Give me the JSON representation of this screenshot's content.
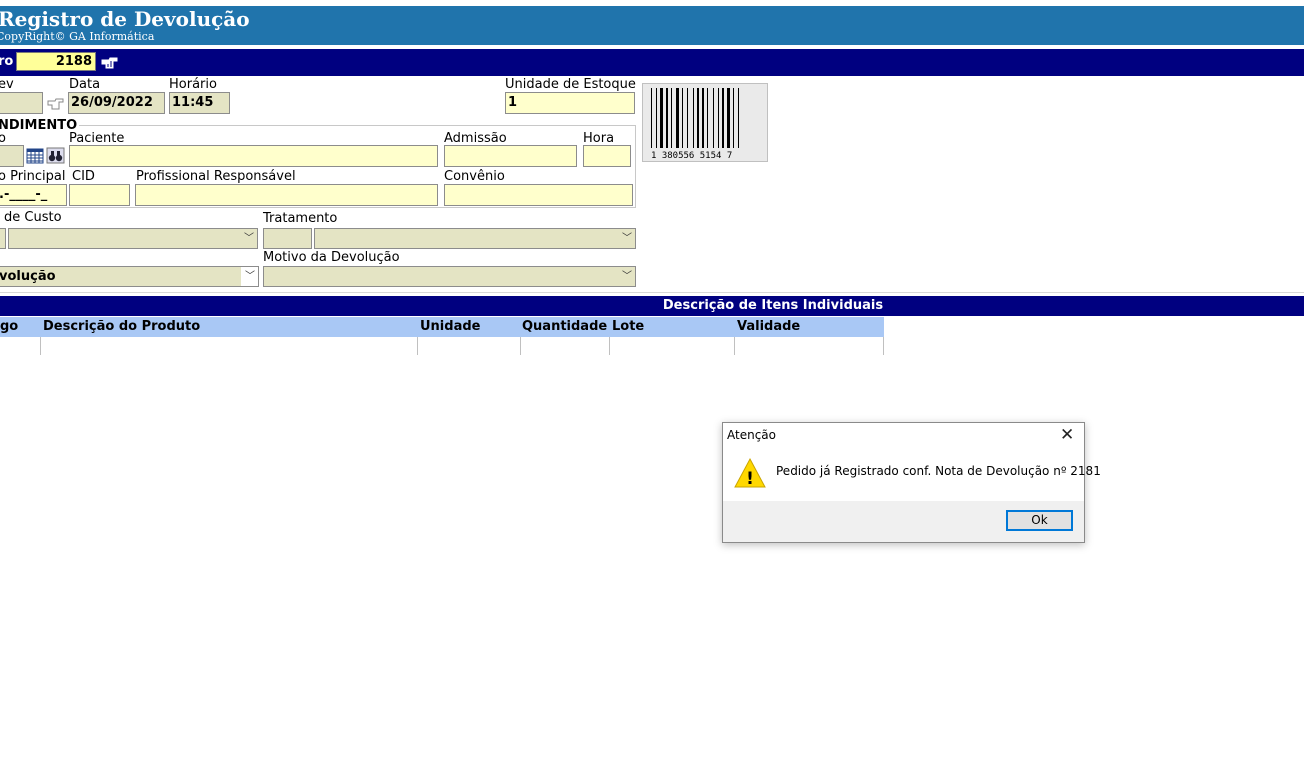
{
  "header": {
    "title": "Registro de Devolução",
    "copyright": "CopyRight© GA Informática"
  },
  "doc_bar": {
    "label": "ro",
    "number": "2188"
  },
  "fields": {
    "dev_label": "ev",
    "dev_value": "",
    "data_label": "Data",
    "data_value": "26/09/2022",
    "horario_label": "Horário",
    "horario_value": "11:45",
    "unidade_estoque_label": "Unidade de Estoque",
    "unidade_estoque_value": "1"
  },
  "atendimento": {
    "title": "NDIMENTO",
    "col0_label": "o",
    "paciente_label": "Paciente",
    "admissao_label": "Admissão",
    "hora_label": "Hora",
    "principal_label": "o Principal",
    "principal_mask": ".-____-_",
    "cid_label": "CID",
    "profissional_label": "Profissional Responsável",
    "convenio_label": "Convênio"
  },
  "custo": {
    "label": "de Custo"
  },
  "tratamento": {
    "label": "Tratamento"
  },
  "tipo_devolucao": {
    "value": "volução"
  },
  "motivo": {
    "label": "Motivo da Devolução"
  },
  "barcode": {
    "digits": "1  380556 5154  7"
  },
  "items_section": {
    "title": "Descrição de Itens Individuais",
    "columns": [
      "go",
      "Descrição do Produto",
      "Unidade",
      "Quantidade",
      "Lote",
      "Validade"
    ]
  },
  "dialog": {
    "title": "Atenção",
    "close": "✕",
    "message": "Pedido já Registrado conf. Nota de Devolução nº 2181",
    "ok_label": "Ok",
    "warning_glyph": "!"
  }
}
